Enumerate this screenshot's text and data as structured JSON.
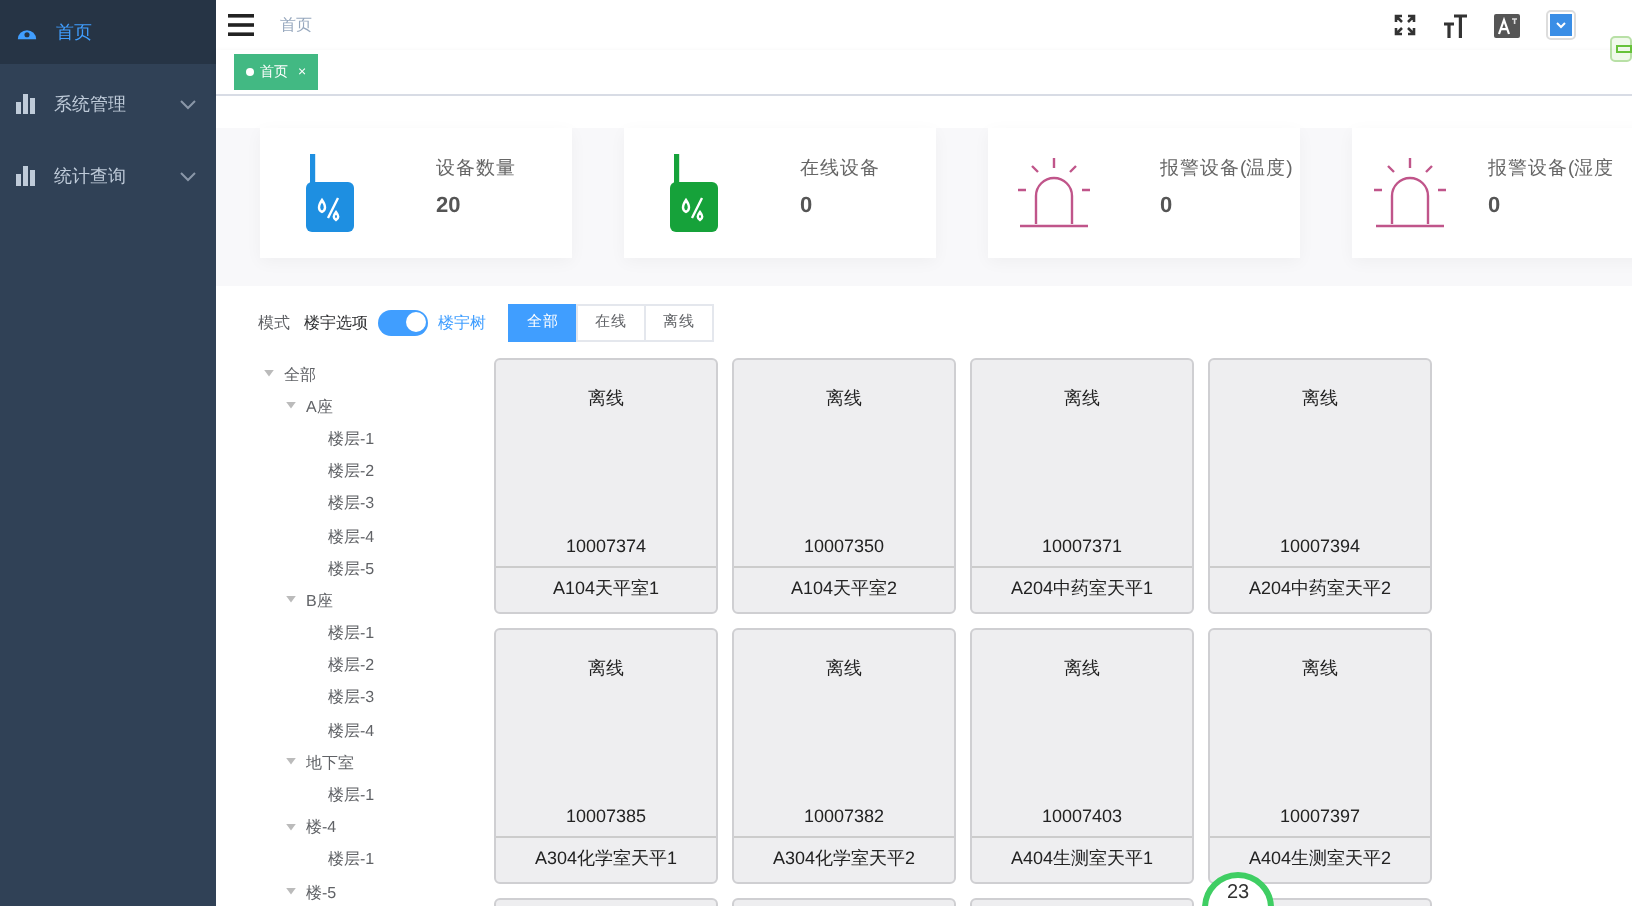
{
  "sidebar": {
    "items": [
      {
        "label": "首页",
        "kind": "home",
        "selected": true
      },
      {
        "label": "系统管理",
        "kind": "menu",
        "selected": false,
        "expanded": false
      },
      {
        "label": "统计查询",
        "kind": "menu",
        "selected": false,
        "expanded": false
      }
    ]
  },
  "header": {
    "breadcrumb": "首页"
  },
  "tags": [
    {
      "label": "首页",
      "close": "×",
      "selected": true
    }
  ],
  "stats": [
    {
      "kind": "device",
      "color": "#1e8fe1",
      "label": "设备数量",
      "value": "20"
    },
    {
      "kind": "device",
      "color": "#16a23a",
      "label": "在线设备",
      "value": "0"
    },
    {
      "kind": "alarm",
      "color": "#c0558a",
      "label": "报警设备(温度)",
      "value": "0"
    },
    {
      "kind": "alarm",
      "color": "#c0558a",
      "label": "报警设备(湿度",
      "value": "0"
    }
  ],
  "mode": {
    "label": "模式",
    "off_label": "楼宇选项",
    "on_label": "楼宇树",
    "on": true
  },
  "filters": [
    {
      "label": "全部",
      "selected": true
    },
    {
      "label": "在线",
      "selected": false
    },
    {
      "label": "离线",
      "selected": false
    }
  ],
  "tree": [
    {
      "label": "全部",
      "expanded": true,
      "children": [
        {
          "label": "A座",
          "expanded": true,
          "children": [
            {
              "label": "楼层-1"
            },
            {
              "label": "楼层-2"
            },
            {
              "label": "楼层-3"
            },
            {
              "label": "楼层-4"
            },
            {
              "label": "楼层-5"
            }
          ]
        },
        {
          "label": "B座",
          "expanded": true,
          "children": [
            {
              "label": "楼层-1"
            },
            {
              "label": "楼层-2"
            },
            {
              "label": "楼层-3"
            },
            {
              "label": "楼层-4"
            }
          ]
        },
        {
          "label": "地下室",
          "expanded": true,
          "children": [
            {
              "label": "楼层-1"
            }
          ]
        },
        {
          "label": "楼-4",
          "expanded": true,
          "children": [
            {
              "label": "楼层-1"
            }
          ]
        },
        {
          "label": "楼-5",
          "expanded": true
        }
      ]
    }
  ],
  "devices": [
    {
      "status": "离线",
      "id": "10007374",
      "name": "A104天平室1"
    },
    {
      "status": "离线",
      "id": "10007350",
      "name": "A104天平室2"
    },
    {
      "status": "离线",
      "id": "10007371",
      "name": "A204中药室天平1"
    },
    {
      "status": "离线",
      "id": "10007394",
      "name": "A204中药室天平2"
    },
    {
      "status": "离线",
      "id": "10007385",
      "name": "A304化学室天平1"
    },
    {
      "status": "离线",
      "id": "10007382",
      "name": "A304化学室天平2"
    },
    {
      "status": "离线",
      "id": "10007403",
      "name": "A404生测室天平1"
    },
    {
      "status": "离线",
      "id": "10007397",
      "name": "A404生测室天平2"
    }
  ],
  "floating_badge": {
    "text": "23"
  }
}
